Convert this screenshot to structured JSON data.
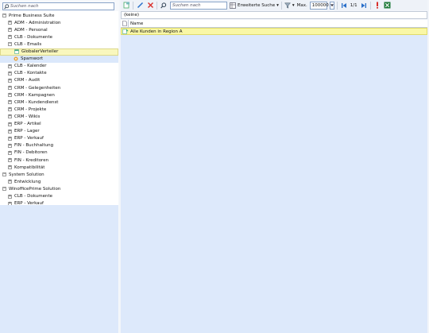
{
  "left": {
    "search_placeholder": "Suchen nach",
    "tree": [
      {
        "label": "Prime Business Suite",
        "indent": 0,
        "exp": "−"
      },
      {
        "label": "ADM - Administration",
        "indent": 1,
        "exp": "+"
      },
      {
        "label": "ADM - Personal",
        "indent": 1,
        "exp": "+"
      },
      {
        "label": "CLB - Dokumente",
        "indent": 1,
        "exp": "+"
      },
      {
        "label": "CLB - Emails",
        "indent": 1,
        "exp": "−"
      },
      {
        "label": "GlobalerVerteiler",
        "indent": 2,
        "exp": "",
        "state": "selected"
      },
      {
        "label": "Spamwort",
        "indent": 2,
        "exp": "",
        "state": "hover"
      },
      {
        "label": "CLB - Kalender",
        "indent": 1,
        "exp": "+"
      },
      {
        "label": "CLB - Kontakte",
        "indent": 1,
        "exp": "+"
      },
      {
        "label": "CRM - Audit",
        "indent": 1,
        "exp": "+"
      },
      {
        "label": "CRM - Gelegenheiten",
        "indent": 1,
        "exp": "+"
      },
      {
        "label": "CRM - Kampagnen",
        "indent": 1,
        "exp": "+"
      },
      {
        "label": "CRM - Kundendienst",
        "indent": 1,
        "exp": "+"
      },
      {
        "label": "CRM - Projekte",
        "indent": 1,
        "exp": "+"
      },
      {
        "label": "CRM - Wikis",
        "indent": 1,
        "exp": "+"
      },
      {
        "label": "ERP - Artikel",
        "indent": 1,
        "exp": "+"
      },
      {
        "label": "ERP - Lager",
        "indent": 1,
        "exp": "+"
      },
      {
        "label": "ERP - Verkauf",
        "indent": 1,
        "exp": "+"
      },
      {
        "label": "FIN - Buchhaltung",
        "indent": 1,
        "exp": "+"
      },
      {
        "label": "FIN - Debitoren",
        "indent": 1,
        "exp": "+"
      },
      {
        "label": "FIN - Kreditoren",
        "indent": 1,
        "exp": "+"
      },
      {
        "label": "Kompatibilität",
        "indent": 1,
        "exp": "+"
      },
      {
        "label": "System Solution",
        "indent": 0,
        "exp": "−"
      },
      {
        "label": "Entwicklung",
        "indent": 1,
        "exp": "+"
      },
      {
        "label": "WinofficePrime Solution",
        "indent": 0,
        "exp": "−"
      },
      {
        "label": "CLB - Dokumente",
        "indent": 1,
        "exp": "+"
      },
      {
        "label": "ERP - Verkauf",
        "indent": 1,
        "exp": "+"
      }
    ]
  },
  "toolbar": {
    "search_placeholder": "Suchen nach",
    "extended_search_label": "Erweiterte Suche",
    "max_label": "Max.",
    "max_value": "100000",
    "page_indicator": "1/1"
  },
  "filter": {
    "value": "(keine)"
  },
  "grid": {
    "column_name": "Name",
    "rows": [
      "Alle Kunden in Region A"
    ]
  },
  "colors": {
    "selection": "#f9f7a6",
    "panel_bg": "#dde9fb",
    "accent_blue": "#2a6fc9",
    "delete_red": "#d9302c"
  }
}
